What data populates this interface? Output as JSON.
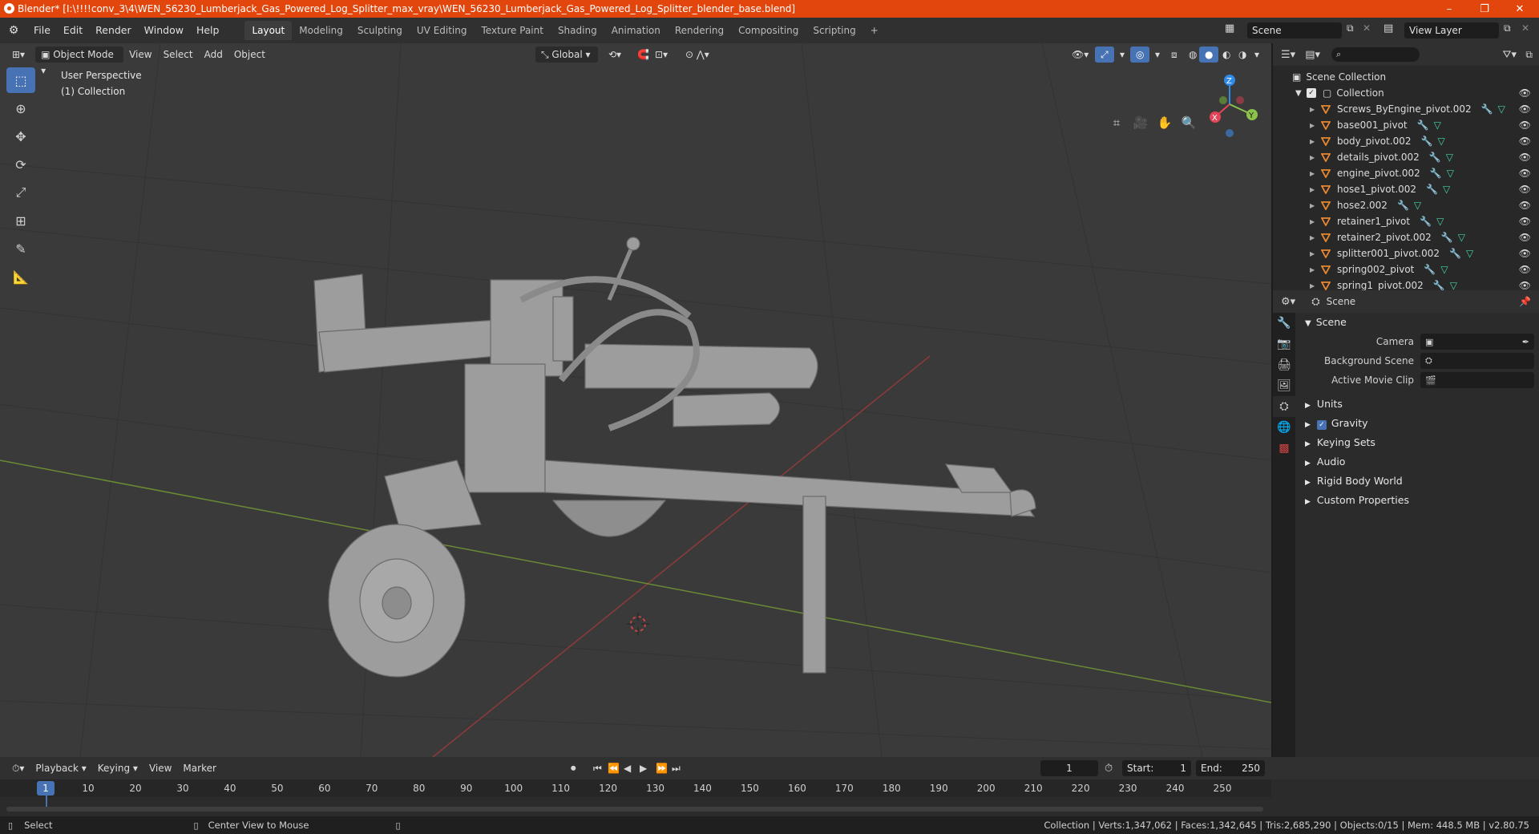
{
  "window": {
    "title": "Blender* [I:\\!!!!conv_3\\4\\WEN_56230_Lumberjack_Gas_Powered_Log_Splitter_max_vray\\WEN_56230_Lumberjack_Gas_Powered_Log_Splitter_blender_base.blend]",
    "minimize": "–",
    "restore": "❐",
    "close": "✕"
  },
  "menu": [
    "File",
    "Edit",
    "Render",
    "Window",
    "Help"
  ],
  "workspaces": [
    "Layout",
    "Modeling",
    "Sculpting",
    "UV Editing",
    "Texture Paint",
    "Shading",
    "Animation",
    "Rendering",
    "Compositing",
    "Scripting"
  ],
  "add_workspace": "+",
  "scene_field": "Scene",
  "view_layer_field": "View Layer",
  "viewport": {
    "mode": "Object Mode",
    "menus": [
      "View",
      "Select",
      "Add",
      "Object"
    ],
    "orientation": "Global",
    "info_line1": "User Perspective",
    "info_line2": "(1) Collection",
    "gizmo": {
      "x": "X",
      "y": "Y",
      "z": "Z"
    }
  },
  "outliner": {
    "search_placeholder": "",
    "scene_collection": "Scene Collection",
    "collection": "Collection",
    "items": [
      "Screws_ByEngine_pivot.002",
      "base001_pivot",
      "body_pivot.002",
      "details_pivot.002",
      "engine_pivot.002",
      "hose1_pivot.002",
      "hose2.002",
      "retainer1_pivot",
      "retainer2_pivot.002",
      "splitter001_pivot.002",
      "spring002_pivot",
      "spring1_pivot.002"
    ]
  },
  "properties": {
    "header": "Scene",
    "panel": "Scene",
    "camera_label": "Camera",
    "background_scene_label": "Background Scene",
    "active_movie_clip_label": "Active Movie Clip",
    "subpanels": [
      "Units",
      "Gravity",
      "Keying Sets",
      "Audio",
      "Rigid Body World",
      "Custom Properties"
    ],
    "gravity_checked": true
  },
  "timeline": {
    "menus": [
      "Playback",
      "Keying",
      "View",
      "Marker"
    ],
    "current_frame": "1",
    "start_label": "Start:",
    "start": "1",
    "end_label": "End:",
    "end": "250",
    "ticks": [
      "1",
      "10",
      "20",
      "30",
      "40",
      "50",
      "60",
      "70",
      "80",
      "90",
      "100",
      "110",
      "120",
      "130",
      "140",
      "150",
      "160",
      "170",
      "180",
      "190",
      "200",
      "210",
      "220",
      "230",
      "240",
      "250"
    ]
  },
  "status": {
    "left1": "Select",
    "left2": "Center View to Mouse",
    "right": "Collection | Verts:1,347,062 | Faces:1,342,645 | Tris:2,685,290 | Objects:0/15 | Mem: 448.5 MB | v2.80.75"
  },
  "colors": {
    "title_bar": "#e3460c",
    "accent": "#4772b3",
    "object_icon": "#e8892e",
    "mesh_icon": "#45d5a3",
    "modifier_icon": "#7aa8ff",
    "x_axis": "#e2455a",
    "y_axis": "#8bc34a",
    "z_axis": "#2f8be8"
  }
}
